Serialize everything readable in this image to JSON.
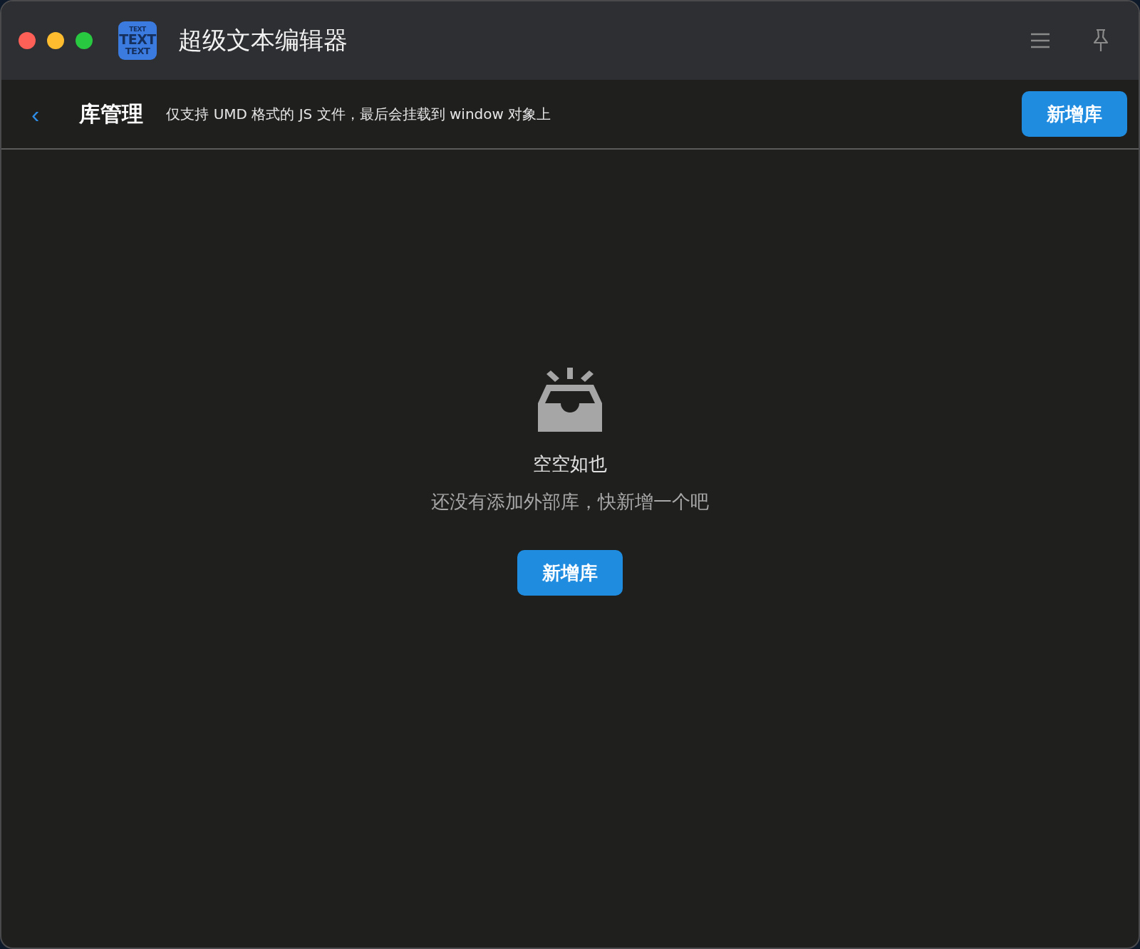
{
  "window": {
    "title": "超级文本编辑器",
    "logo": {
      "lines": [
        "TEXT",
        "TEXT",
        "TEXT"
      ]
    }
  },
  "header": {
    "back": "‹",
    "title": "库管理",
    "description": "仅支持 UMD 格式的 JS 文件，最后会挂载到 window 对象上",
    "button": "新增库"
  },
  "empty_state": {
    "title": "空空如也",
    "message": "还没有添加外部库，快新增一个吧",
    "button": "新增库"
  }
}
